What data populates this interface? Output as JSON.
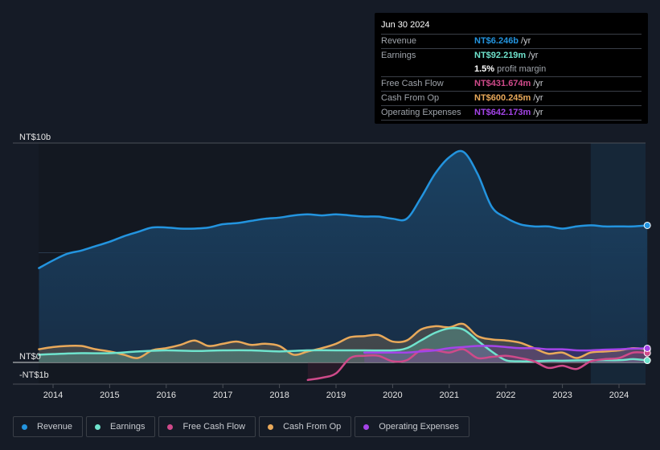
{
  "tooltip": {
    "date": "Jun 30 2024",
    "rows": [
      {
        "label": "Revenue",
        "value": "NT$6.246b",
        "unit": "/yr",
        "color": "#2394df"
      },
      {
        "label": "Earnings",
        "value": "NT$92.219m",
        "unit": "/yr",
        "color": "#6fe3cd"
      },
      {
        "label": "",
        "margin_pct": "1.5%",
        "margin_text": "profit margin"
      },
      {
        "label": "Free Cash Flow",
        "value": "NT$431.674m",
        "unit": "/yr",
        "color": "#cf4a8a"
      },
      {
        "label": "Cash From Op",
        "value": "NT$600.245m",
        "unit": "/yr",
        "color": "#e9a95a"
      },
      {
        "label": "Operating Expenses",
        "value": "NT$642.173m",
        "unit": "/yr",
        "color": "#a444e8"
      }
    ]
  },
  "legend": [
    {
      "label": "Revenue",
      "color": "#2394df"
    },
    {
      "label": "Earnings",
      "color": "#6fe3cd"
    },
    {
      "label": "Free Cash Flow",
      "color": "#cf4a8a"
    },
    {
      "label": "Cash From Op",
      "color": "#e9a95a"
    },
    {
      "label": "Operating Expenses",
      "color": "#a444e8"
    }
  ],
  "chart_data": {
    "type": "area",
    "title": "",
    "xlabel": "",
    "ylabel": "",
    "currency": "NT$",
    "units": "billions",
    "xlim": [
      2013.75,
      2024.5
    ],
    "ylim": [
      -1,
      10
    ],
    "y_tick_labels": [
      {
        "value": 10,
        "label": "NT$10b"
      },
      {
        "value": 0,
        "label": "NT$0"
      },
      {
        "value": -1,
        "label": "-NT$1b"
      }
    ],
    "x_ticks": [
      2014,
      2015,
      2016,
      2017,
      2018,
      2019,
      2020,
      2021,
      2022,
      2023,
      2024
    ],
    "x_tick_labels": [
      "2014",
      "2015",
      "2016",
      "2017",
      "2018",
      "2019",
      "2020",
      "2021",
      "2022",
      "2023",
      "2024"
    ],
    "highlight_from": 2023.5,
    "grid": true,
    "legend_position": "bottom",
    "series": [
      {
        "name": "Revenue",
        "color": "#2394df",
        "x": [
          2013.75,
          2014.0,
          2014.25,
          2014.5,
          2014.75,
          2015.0,
          2015.25,
          2015.5,
          2015.75,
          2016.0,
          2016.25,
          2016.5,
          2016.75,
          2017.0,
          2017.25,
          2017.5,
          2017.75,
          2018.0,
          2018.25,
          2018.5,
          2018.75,
          2019.0,
          2019.25,
          2019.5,
          2019.75,
          2020.0,
          2020.25,
          2020.5,
          2020.75,
          2021.0,
          2021.25,
          2021.5,
          2021.75,
          2022.0,
          2022.25,
          2022.5,
          2022.75,
          2023.0,
          2023.25,
          2023.5,
          2023.75,
          2024.0,
          2024.25,
          2024.5
        ],
        "values": [
          4.3,
          4.65,
          4.95,
          5.1,
          5.3,
          5.5,
          5.75,
          5.95,
          6.15,
          6.15,
          6.1,
          6.1,
          6.15,
          6.3,
          6.35,
          6.45,
          6.55,
          6.6,
          6.7,
          6.75,
          6.7,
          6.75,
          6.7,
          6.65,
          6.65,
          6.55,
          6.55,
          7.5,
          8.6,
          9.35,
          9.6,
          8.6,
          7.1,
          6.6,
          6.3,
          6.2,
          6.2,
          6.1,
          6.2,
          6.25,
          6.2,
          6.2,
          6.2,
          6.246
        ]
      },
      {
        "name": "Earnings",
        "color": "#6fe3cd",
        "x": [
          2013.75,
          2014.0,
          2014.5,
          2015.0,
          2015.5,
          2016.0,
          2016.5,
          2017.0,
          2017.5,
          2018.0,
          2018.5,
          2019.0,
          2019.5,
          2020.0,
          2020.25,
          2020.5,
          2020.75,
          2021.0,
          2021.25,
          2021.5,
          2021.75,
          2022.0,
          2022.25,
          2022.5,
          2022.75,
          2023.0,
          2023.5,
          2024.0,
          2024.25,
          2024.5
        ],
        "values": [
          0.35,
          0.38,
          0.42,
          0.42,
          0.5,
          0.55,
          0.52,
          0.55,
          0.55,
          0.5,
          0.55,
          0.55,
          0.55,
          0.55,
          0.65,
          1.0,
          1.35,
          1.55,
          1.5,
          1.0,
          0.5,
          0.1,
          0.05,
          0.05,
          0.08,
          0.08,
          0.1,
          0.1,
          0.15,
          0.09
        ]
      },
      {
        "name": "Free Cash Flow",
        "color": "#cf4a8a",
        "x": [
          2018.5,
          2018.75,
          2019.0,
          2019.25,
          2019.5,
          2019.75,
          2020.0,
          2020.25,
          2020.5,
          2020.75,
          2021.0,
          2021.25,
          2021.5,
          2021.75,
          2022.0,
          2022.25,
          2022.5,
          2022.75,
          2023.0,
          2023.25,
          2023.5,
          2023.75,
          2024.0,
          2024.25,
          2024.5
        ],
        "values": [
          -0.8,
          -0.7,
          -0.5,
          0.2,
          0.3,
          0.3,
          0.05,
          0.1,
          0.55,
          0.55,
          0.45,
          0.6,
          0.2,
          0.25,
          0.3,
          0.2,
          0.05,
          -0.25,
          -0.15,
          -0.3,
          0.05,
          0.15,
          0.2,
          0.45,
          0.43
        ]
      },
      {
        "name": "Cash From Op",
        "color": "#e9a95a",
        "x": [
          2013.75,
          2014.0,
          2014.25,
          2014.5,
          2014.75,
          2015.0,
          2015.25,
          2015.5,
          2015.75,
          2016.0,
          2016.25,
          2016.5,
          2016.75,
          2017.0,
          2017.25,
          2017.5,
          2017.75,
          2018.0,
          2018.25,
          2018.5,
          2018.75,
          2019.0,
          2019.25,
          2019.5,
          2019.75,
          2020.0,
          2020.25,
          2020.5,
          2020.75,
          2021.0,
          2021.25,
          2021.5,
          2021.75,
          2022.0,
          2022.25,
          2022.5,
          2022.75,
          2023.0,
          2023.25,
          2023.5,
          2023.75,
          2024.0,
          2024.25,
          2024.5
        ],
        "values": [
          0.6,
          0.7,
          0.75,
          0.75,
          0.6,
          0.5,
          0.35,
          0.2,
          0.55,
          0.65,
          0.8,
          1.0,
          0.75,
          0.85,
          0.95,
          0.8,
          0.85,
          0.75,
          0.35,
          0.5,
          0.65,
          0.85,
          1.15,
          1.2,
          1.25,
          0.95,
          1.0,
          1.5,
          1.65,
          1.6,
          1.75,
          1.2,
          1.05,
          1.0,
          0.9,
          0.65,
          0.4,
          0.45,
          0.2,
          0.45,
          0.5,
          0.55,
          0.65,
          0.6
        ]
      },
      {
        "name": "Operating Expenses",
        "color": "#a444e8",
        "x": [
          2019.5,
          2019.75,
          2020.0,
          2020.25,
          2020.5,
          2020.75,
          2021.0,
          2021.25,
          2021.5,
          2021.75,
          2022.0,
          2022.25,
          2022.5,
          2022.75,
          2023.0,
          2023.25,
          2023.5,
          2023.75,
          2024.0,
          2024.25,
          2024.5
        ],
        "values": [
          0.45,
          0.45,
          0.45,
          0.45,
          0.5,
          0.55,
          0.65,
          0.7,
          0.75,
          0.75,
          0.7,
          0.65,
          0.65,
          0.6,
          0.6,
          0.55,
          0.55,
          0.58,
          0.6,
          0.63,
          0.642
        ]
      }
    ]
  }
}
